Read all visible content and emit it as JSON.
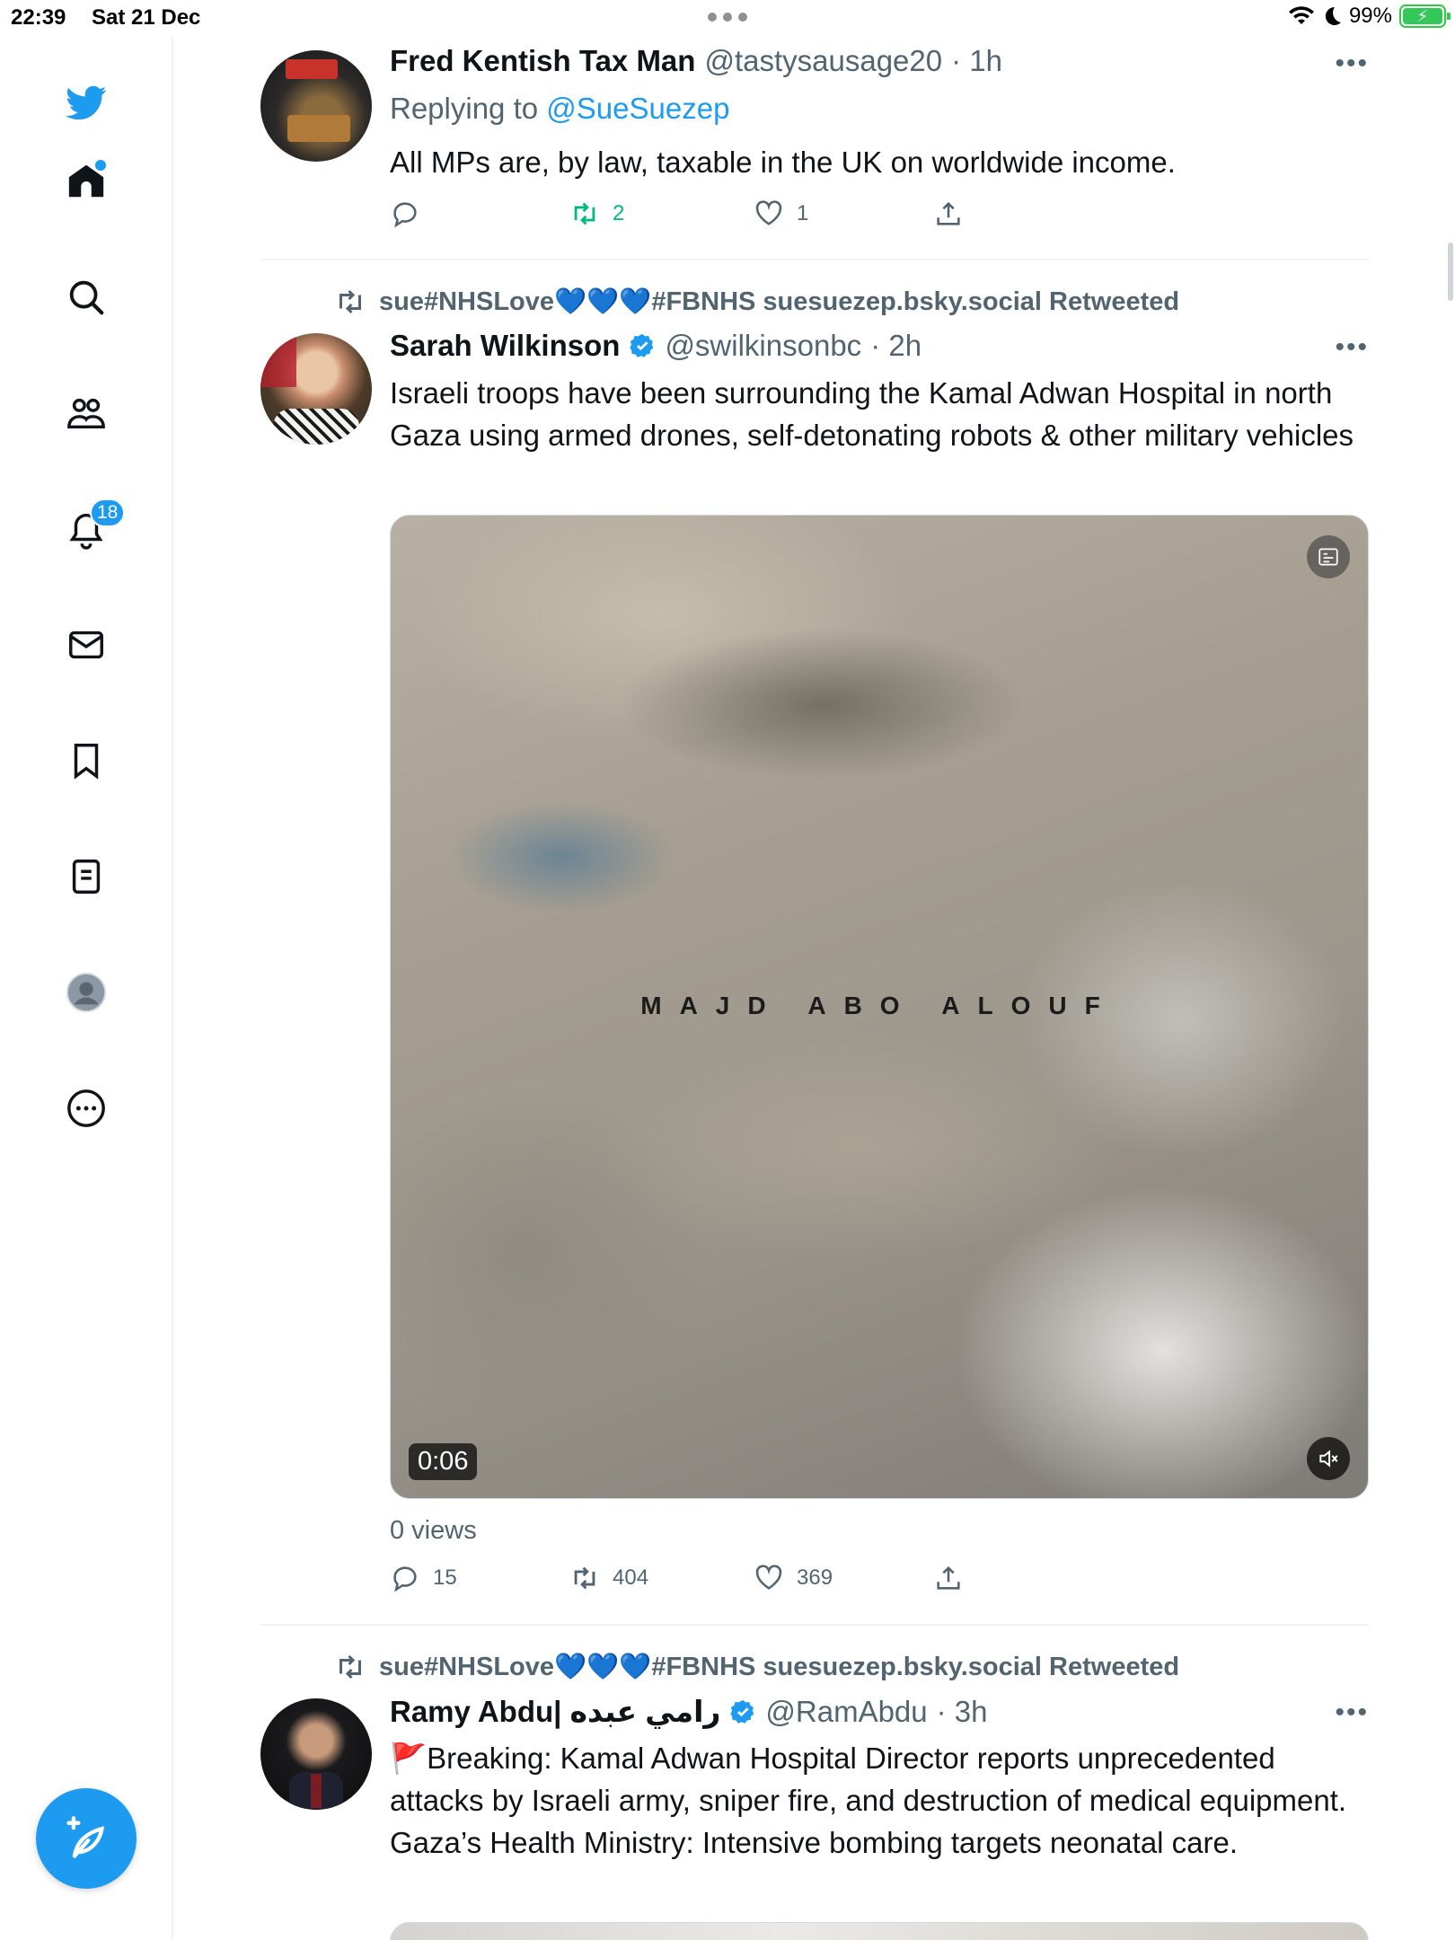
{
  "status_bar": {
    "time": "22:39",
    "date": "Sat 21 Dec",
    "battery": "99%",
    "battery_level": 0.99
  },
  "sidebar": {
    "items": [
      {
        "icon": "twitter-bird-icon"
      },
      {
        "icon": "home-icon"
      },
      {
        "icon": "search-icon"
      },
      {
        "icon": "communities-icon"
      },
      {
        "icon": "notifications-bell-icon",
        "badge": "18"
      },
      {
        "icon": "messages-envelope-icon"
      },
      {
        "icon": "bookmark-icon"
      },
      {
        "icon": "lists-icon"
      },
      {
        "icon": "profile-avatar-icon"
      },
      {
        "icon": "more-circle-icon"
      }
    ],
    "compose_icon": "compose-feather-icon"
  },
  "colors": {
    "accent": "#1d9bf0",
    "retweet_green": "#00ba7c",
    "muted": "#536471",
    "text": "#0f1419"
  },
  "tweets": [
    {
      "display_name": "Fred Kentish Tax Man",
      "handle": "@tastysausage20",
      "time": "· 1h",
      "replying_label": "Replying to",
      "replying_to": "@SueSuezep",
      "text": "All MPs are, by law, taxable in the UK on worldwide income.",
      "replies": "",
      "retweets": "2",
      "likes": "1"
    },
    {
      "retweeted_by": "sue#NHSLove💙💙💙#FBNHS suesuezep.bsky.social Retweeted",
      "display_name": "Sarah Wilkinson",
      "handle": "@swilkinsonbc",
      "time": "· 2h",
      "text": "Israeli troops have been surrounding the Kamal Adwan Hospital in north Gaza using armed drones, self-detonating robots & other military vehicles",
      "media": {
        "watermark": "MAJD ABO ALOUF",
        "duration": "0:06"
      },
      "views": "0 views",
      "replies": "15",
      "retweets": "404",
      "likes": "369"
    },
    {
      "retweeted_by": "sue#NHSLove💙💙💙#FBNHS suesuezep.bsky.social Retweeted",
      "display_name": "Ramy Abdu| رامي عبده",
      "handle": "@RamAbdu",
      "time": "· 3h",
      "text": "🚩Breaking: Kamal Adwan Hospital Director reports unprecedented attacks by Israeli army, sniper fire, and destruction of medical equipment. Gaza’s Health Ministry: Intensive bombing targets neonatal care."
    }
  ]
}
